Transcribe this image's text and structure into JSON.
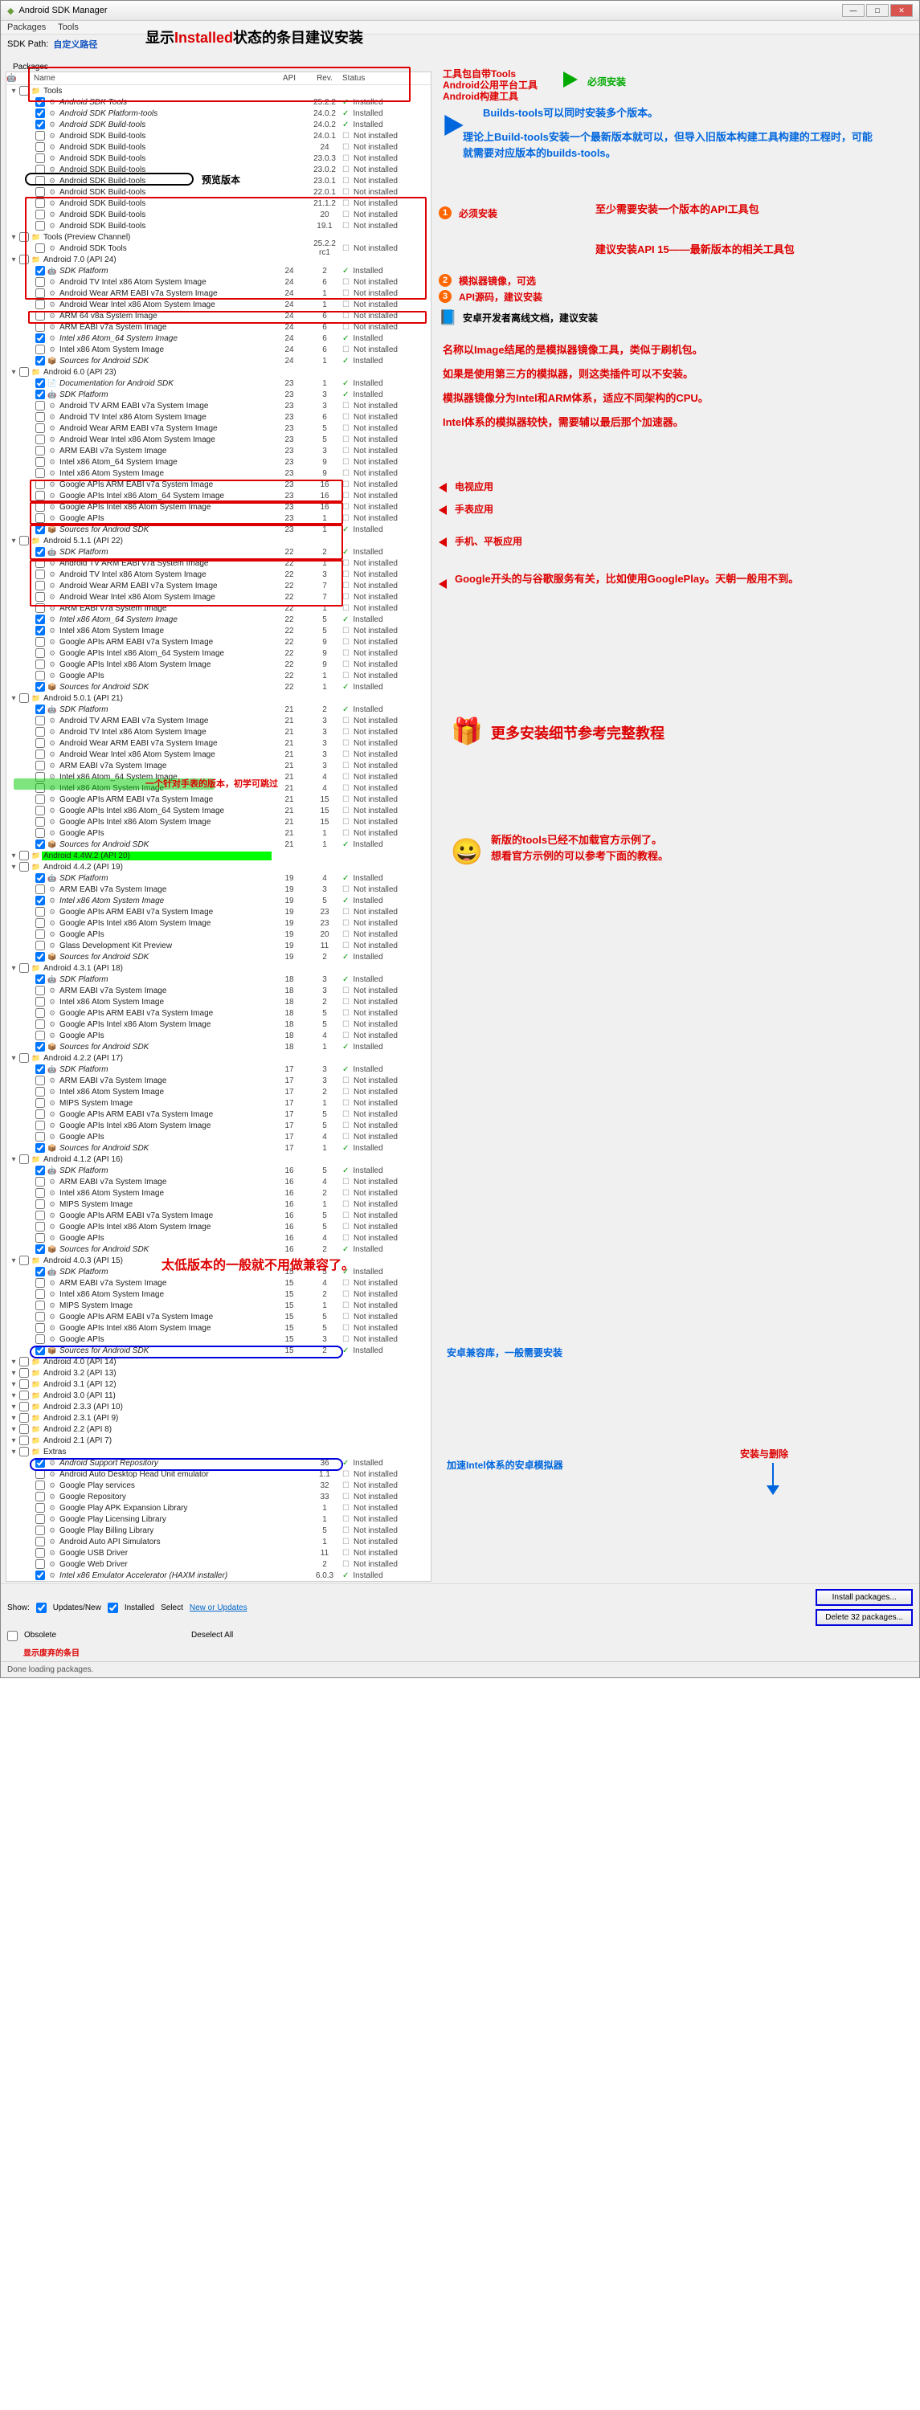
{
  "window": {
    "title": "Android SDK Manager"
  },
  "menu": {
    "packages": "Packages",
    "tools": "Tools"
  },
  "sdk": {
    "label": "SDK Path:",
    "path": "自定义路径"
  },
  "banner": {
    "pre": "显示",
    "mid": "Installed",
    "post": "状态的条目建议安装"
  },
  "cols": {
    "name": "Name",
    "api": "API",
    "rev": "Rev.",
    "status": "Status"
  },
  "status": {
    "installed": "Installed",
    "not": "Not installed"
  },
  "groups": [
    {
      "name": "Tools",
      "items": [
        {
          "n": "Android SDK Tools",
          "api": "",
          "rev": "25.2.2",
          "s": "i",
          "c": true
        },
        {
          "n": "Android SDK Platform-tools",
          "api": "",
          "rev": "24.0.2",
          "s": "i",
          "c": true
        },
        {
          "n": "Android SDK Build-tools",
          "api": "",
          "rev": "24.0.2",
          "s": "i",
          "c": true
        },
        {
          "n": "Android SDK Build-tools",
          "api": "",
          "rev": "24.0.1",
          "s": "n"
        },
        {
          "n": "Android SDK Build-tools",
          "api": "",
          "rev": "24",
          "s": "n"
        },
        {
          "n": "Android SDK Build-tools",
          "api": "",
          "rev": "23.0.3",
          "s": "n"
        },
        {
          "n": "Android SDK Build-tools",
          "api": "",
          "rev": "23.0.2",
          "s": "n"
        },
        {
          "n": "Android SDK Build-tools",
          "api": "",
          "rev": "23.0.1",
          "s": "n"
        },
        {
          "n": "Android SDK Build-tools",
          "api": "",
          "rev": "22.0.1",
          "s": "n"
        },
        {
          "n": "Android SDK Build-tools",
          "api": "",
          "rev": "21.1.2",
          "s": "n"
        },
        {
          "n": "Android SDK Build-tools",
          "api": "",
          "rev": "20",
          "s": "n"
        },
        {
          "n": "Android SDK Build-tools",
          "api": "",
          "rev": "19.1",
          "s": "n"
        }
      ]
    },
    {
      "name": "Tools (Preview Channel)",
      "items": [
        {
          "n": "Android SDK Tools",
          "api": "",
          "rev": "25.2.2 rc1",
          "s": "n"
        }
      ]
    },
    {
      "name": "Android 7.0 (API 24)",
      "items": [
        {
          "n": "SDK Platform",
          "api": "24",
          "rev": "2",
          "s": "i",
          "c": true
        },
        {
          "n": "Android TV Intel x86 Atom System Image",
          "api": "24",
          "rev": "6",
          "s": "n"
        },
        {
          "n": "Android Wear ARM EABI v7a System Image",
          "api": "24",
          "rev": "1",
          "s": "n"
        },
        {
          "n": "Android Wear Intel x86 Atom System Image",
          "api": "24",
          "rev": "1",
          "s": "n"
        },
        {
          "n": "ARM 64 v8a System Image",
          "api": "24",
          "rev": "6",
          "s": "n"
        },
        {
          "n": "ARM EABI v7a System Image",
          "api": "24",
          "rev": "6",
          "s": "n"
        },
        {
          "n": "Intel x86 Atom_64 System Image",
          "api": "24",
          "rev": "6",
          "s": "i",
          "c": true
        },
        {
          "n": "Intel x86 Atom System Image",
          "api": "24",
          "rev": "6",
          "s": "n"
        },
        {
          "n": "Sources for Android SDK",
          "api": "24",
          "rev": "1",
          "s": "i",
          "c": true
        }
      ]
    },
    {
      "name": "Android 6.0 (API 23)",
      "items": [
        {
          "n": "Documentation for Android SDK",
          "api": "23",
          "rev": "1",
          "s": "i",
          "c": true
        },
        {
          "n": "SDK Platform",
          "api": "23",
          "rev": "3",
          "s": "i",
          "c": true
        },
        {
          "n": "Android TV ARM EABI v7a System Image",
          "api": "23",
          "rev": "3",
          "s": "n"
        },
        {
          "n": "Android TV Intel x86 Atom System Image",
          "api": "23",
          "rev": "6",
          "s": "n"
        },
        {
          "n": "Android Wear ARM EABI v7a System Image",
          "api": "23",
          "rev": "5",
          "s": "n"
        },
        {
          "n": "Android Wear Intel x86 Atom System Image",
          "api": "23",
          "rev": "5",
          "s": "n"
        },
        {
          "n": "ARM EABI v7a System Image",
          "api": "23",
          "rev": "3",
          "s": "n"
        },
        {
          "n": "Intel x86 Atom_64 System Image",
          "api": "23",
          "rev": "9",
          "s": "n"
        },
        {
          "n": "Intel x86 Atom System Image",
          "api": "23",
          "rev": "9",
          "s": "n"
        },
        {
          "n": "Google APIs ARM EABI v7a System Image",
          "api": "23",
          "rev": "16",
          "s": "n"
        },
        {
          "n": "Google APIs Intel x86 Atom_64 System Image",
          "api": "23",
          "rev": "16",
          "s": "n"
        },
        {
          "n": "Google APIs Intel x86 Atom System Image",
          "api": "23",
          "rev": "16",
          "s": "n"
        },
        {
          "n": "Google APIs",
          "api": "23",
          "rev": "1",
          "s": "n"
        },
        {
          "n": "Sources for Android SDK",
          "api": "23",
          "rev": "1",
          "s": "i",
          "c": true
        }
      ]
    },
    {
      "name": "Android 5.1.1 (API 22)",
      "items": [
        {
          "n": "SDK Platform",
          "api": "22",
          "rev": "2",
          "s": "i",
          "c": true
        },
        {
          "n": "Android TV ARM EABI v7a System Image",
          "api": "22",
          "rev": "1",
          "s": "n"
        },
        {
          "n": "Android TV Intel x86 Atom System Image",
          "api": "22",
          "rev": "3",
          "s": "n"
        },
        {
          "n": "Android Wear ARM EABI v7a System Image",
          "api": "22",
          "rev": "7",
          "s": "n"
        },
        {
          "n": "Android Wear Intel x86 Atom System Image",
          "api": "22",
          "rev": "7",
          "s": "n"
        },
        {
          "n": "ARM EABI v7a System Image",
          "api": "22",
          "rev": "1",
          "s": "n"
        },
        {
          "n": "Intel x86 Atom_64 System Image",
          "api": "22",
          "rev": "5",
          "s": "i",
          "c": true
        },
        {
          "n": "Intel x86 Atom System Image",
          "api": "22",
          "rev": "5",
          "s": "n",
          "c": true
        },
        {
          "n": "Google APIs ARM EABI v7a System Image",
          "api": "22",
          "rev": "9",
          "s": "n"
        },
        {
          "n": "Google APIs Intel x86 Atom_64 System Image",
          "api": "22",
          "rev": "9",
          "s": "n"
        },
        {
          "n": "Google APIs Intel x86 Atom System Image",
          "api": "22",
          "rev": "9",
          "s": "n"
        },
        {
          "n": "Google APIs",
          "api": "22",
          "rev": "1",
          "s": "n"
        },
        {
          "n": "Sources for Android SDK",
          "api": "22",
          "rev": "1",
          "s": "i",
          "c": true
        }
      ]
    },
    {
      "name": "Android 5.0.1 (API 21)",
      "items": [
        {
          "n": "SDK Platform",
          "api": "21",
          "rev": "2",
          "s": "i",
          "c": true
        },
        {
          "n": "Android TV ARM EABI v7a System Image",
          "api": "21",
          "rev": "3",
          "s": "n"
        },
        {
          "n": "Android TV Intel x86 Atom System Image",
          "api": "21",
          "rev": "3",
          "s": "n"
        },
        {
          "n": "Android Wear ARM EABI v7a System Image",
          "api": "21",
          "rev": "3",
          "s": "n"
        },
        {
          "n": "Android Wear Intel x86 Atom System Image",
          "api": "21",
          "rev": "3",
          "s": "n"
        },
        {
          "n": "ARM EABI v7a System Image",
          "api": "21",
          "rev": "3",
          "s": "n"
        },
        {
          "n": "Intel x86 Atom_64 System Image",
          "api": "21",
          "rev": "4",
          "s": "n"
        },
        {
          "n": "Intel x86 Atom System Image",
          "api": "21",
          "rev": "4",
          "s": "n"
        },
        {
          "n": "Google APIs ARM EABI v7a System Image",
          "api": "21",
          "rev": "15",
          "s": "n"
        },
        {
          "n": "Google APIs Intel x86 Atom_64 System Image",
          "api": "21",
          "rev": "15",
          "s": "n"
        },
        {
          "n": "Google APIs Intel x86 Atom System Image",
          "api": "21",
          "rev": "15",
          "s": "n"
        },
        {
          "n": "Google APIs",
          "api": "21",
          "rev": "1",
          "s": "n"
        },
        {
          "n": "Sources for Android SDK",
          "api": "21",
          "rev": "1",
          "s": "i",
          "c": true
        }
      ]
    },
    {
      "name": "Android 4.4W.2 (API 20)",
      "hl": "green",
      "items": []
    },
    {
      "name": "Android 4.4.2 (API 19)",
      "items": [
        {
          "n": "SDK Platform",
          "api": "19",
          "rev": "4",
          "s": "i",
          "c": true
        },
        {
          "n": "ARM EABI v7a System Image",
          "api": "19",
          "rev": "3",
          "s": "n"
        },
        {
          "n": "Intel x86 Atom System Image",
          "api": "19",
          "rev": "5",
          "s": "i",
          "c": true
        },
        {
          "n": "Google APIs ARM EABI v7a System Image",
          "api": "19",
          "rev": "23",
          "s": "n"
        },
        {
          "n": "Google APIs Intel x86 Atom System Image",
          "api": "19",
          "rev": "23",
          "s": "n"
        },
        {
          "n": "Google APIs",
          "api": "19",
          "rev": "20",
          "s": "n"
        },
        {
          "n": "Glass Development Kit Preview",
          "api": "19",
          "rev": "11",
          "s": "n"
        },
        {
          "n": "Sources for Android SDK",
          "api": "19",
          "rev": "2",
          "s": "i",
          "c": true
        }
      ]
    },
    {
      "name": "Android 4.3.1 (API 18)",
      "items": [
        {
          "n": "SDK Platform",
          "api": "18",
          "rev": "3",
          "s": "i",
          "c": true
        },
        {
          "n": "ARM EABI v7a System Image",
          "api": "18",
          "rev": "3",
          "s": "n"
        },
        {
          "n": "Intel x86 Atom System Image",
          "api": "18",
          "rev": "2",
          "s": "n"
        },
        {
          "n": "Google APIs ARM EABI v7a System Image",
          "api": "18",
          "rev": "5",
          "s": "n"
        },
        {
          "n": "Google APIs Intel x86 Atom System Image",
          "api": "18",
          "rev": "5",
          "s": "n"
        },
        {
          "n": "Google APIs",
          "api": "18",
          "rev": "4",
          "s": "n"
        },
        {
          "n": "Sources for Android SDK",
          "api": "18",
          "rev": "1",
          "s": "i",
          "c": true
        }
      ]
    },
    {
      "name": "Android 4.2.2 (API 17)",
      "items": [
        {
          "n": "SDK Platform",
          "api": "17",
          "rev": "3",
          "s": "i",
          "c": true
        },
        {
          "n": "ARM EABI v7a System Image",
          "api": "17",
          "rev": "3",
          "s": "n"
        },
        {
          "n": "Intel x86 Atom System Image",
          "api": "17",
          "rev": "2",
          "s": "n"
        },
        {
          "n": "MIPS System Image",
          "api": "17",
          "rev": "1",
          "s": "n"
        },
        {
          "n": "Google APIs ARM EABI v7a System Image",
          "api": "17",
          "rev": "5",
          "s": "n"
        },
        {
          "n": "Google APIs Intel x86 Atom System Image",
          "api": "17",
          "rev": "5",
          "s": "n"
        },
        {
          "n": "Google APIs",
          "api": "17",
          "rev": "4",
          "s": "n"
        },
        {
          "n": "Sources for Android SDK",
          "api": "17",
          "rev": "1",
          "s": "i",
          "c": true
        }
      ]
    },
    {
      "name": "Android 4.1.2 (API 16)",
      "items": [
        {
          "n": "SDK Platform",
          "api": "16",
          "rev": "5",
          "s": "i",
          "c": true
        },
        {
          "n": "ARM EABI v7a System Image",
          "api": "16",
          "rev": "4",
          "s": "n"
        },
        {
          "n": "Intel x86 Atom System Image",
          "api": "16",
          "rev": "2",
          "s": "n"
        },
        {
          "n": "MIPS System Image",
          "api": "16",
          "rev": "1",
          "s": "n"
        },
        {
          "n": "Google APIs ARM EABI v7a System Image",
          "api": "16",
          "rev": "5",
          "s": "n"
        },
        {
          "n": "Google APIs Intel x86 Atom System Image",
          "api": "16",
          "rev": "5",
          "s": "n"
        },
        {
          "n": "Google APIs",
          "api": "16",
          "rev": "4",
          "s": "n"
        },
        {
          "n": "Sources for Android SDK",
          "api": "16",
          "rev": "2",
          "s": "i",
          "c": true
        }
      ]
    },
    {
      "name": "Android 4.0.3 (API 15)",
      "items": [
        {
          "n": "SDK Platform",
          "api": "15",
          "rev": "5",
          "s": "i",
          "c": true
        },
        {
          "n": "ARM EABI v7a System Image",
          "api": "15",
          "rev": "4",
          "s": "n"
        },
        {
          "n": "Intel x86 Atom System Image",
          "api": "15",
          "rev": "2",
          "s": "n"
        },
        {
          "n": "MIPS System Image",
          "api": "15",
          "rev": "1",
          "s": "n"
        },
        {
          "n": "Google APIs ARM EABI v7a System Image",
          "api": "15",
          "rev": "5",
          "s": "n"
        },
        {
          "n": "Google APIs Intel x86 Atom System Image",
          "api": "15",
          "rev": "5",
          "s": "n"
        },
        {
          "n": "Google APIs",
          "api": "15",
          "rev": "3",
          "s": "n"
        },
        {
          "n": "Sources for Android SDK",
          "api": "15",
          "rev": "2",
          "s": "i",
          "c": true
        }
      ]
    },
    {
      "name": "Android 4.0 (API 14)",
      "items": []
    },
    {
      "name": "Android 3.2 (API 13)",
      "items": []
    },
    {
      "name": "Android 3.1 (API 12)",
      "items": []
    },
    {
      "name": "Android 3.0 (API 11)",
      "items": []
    },
    {
      "name": "Android 2.3.3 (API 10)",
      "items": []
    },
    {
      "name": "Android 2.3.1 (API 9)",
      "items": []
    },
    {
      "name": "Android 2.2 (API 8)",
      "items": []
    },
    {
      "name": "Android 2.1 (API 7)",
      "items": []
    },
    {
      "name": "Extras",
      "items": [
        {
          "n": "Android Support Repository",
          "api": "",
          "rev": "36",
          "s": "i",
          "c": true
        },
        {
          "n": "Android Auto Desktop Head Unit emulator",
          "api": "",
          "rev": "1.1",
          "s": "n"
        },
        {
          "n": "Google Play services",
          "api": "",
          "rev": "32",
          "s": "n"
        },
        {
          "n": "Google Repository",
          "api": "",
          "rev": "33",
          "s": "n"
        },
        {
          "n": "Google Play APK Expansion Library",
          "api": "",
          "rev": "1",
          "s": "n"
        },
        {
          "n": "Google Play Licensing Library",
          "api": "",
          "rev": "1",
          "s": "n"
        },
        {
          "n": "Google Play Billing Library",
          "api": "",
          "rev": "5",
          "s": "n"
        },
        {
          "n": "Android Auto API Simulators",
          "api": "",
          "rev": "1",
          "s": "n"
        },
        {
          "n": "Google USB Driver",
          "api": "",
          "rev": "11",
          "s": "n"
        },
        {
          "n": "Google Web Driver",
          "api": "",
          "rev": "2",
          "s": "n"
        },
        {
          "n": "Intel x86 Emulator Accelerator (HAXM installer)",
          "api": "",
          "rev": "6.0.3",
          "s": "i",
          "c": true
        }
      ]
    }
  ],
  "footer": {
    "show": "Show:",
    "updates": "Updates/New",
    "installed": "Installed",
    "select": "Select ",
    "new_up": "New or Updates",
    "obsolete": "Obsolete",
    "deselect": "Deselect All",
    "install_btn": "Install packages...",
    "delete_btn": "Delete 32 packages...",
    "abandoned": "显示废弃的条目"
  },
  "status_bar": "Done loading packages.",
  "anno": {
    "a1": "工具包自带Tools",
    "a2": "Android公用平台工具",
    "a3": "Android构建工具",
    "must": "必须安装",
    "b1": "Builds-tools可以同时安装多个版本。",
    "b2": "理论上Build-tools安装一个最新版本就可以，但导入旧版本构建工具构建的工程时，可能就需要对应版本的builds-tools。",
    "preview": "预览版本",
    "must2": "必须安装",
    "api_pkg": "至少需要安装一个版本的API工具包",
    "api15": "建议安装API 15——最新版本的相关工具包",
    "sim": "模拟器镜像，可选",
    "src": "API源码，建议安装",
    "doc": "安卓开发者离线文档，建议安装",
    "img1": "名称以Image结尾的是模拟器镜像工具，类似于刷机包。",
    "img2": "如果是使用第三方的模拟器，则这类插件可以不安装。",
    "img3": "模拟器镜像分为Intel和ARM体系，适应不同架构的CPU。",
    "img4": "Intel体系的模拟器较快，需要辅以最后那个加速器。",
    "tv": "电视应用",
    "watch": "手表应用",
    "phone": "手机、平板应用",
    "gapi": "Google开头的与谷歌服务有关，比如使用GooglePlay。天朝一般用不到。",
    "more": "更多安装细节参考完整教程",
    "w20": "一个针对手表的版本，初学可跳过",
    "tools_note1": "新版的tools已经不加载官方示例了。",
    "tools_note2": "想看官方示例的可以参考下面的教程。",
    "too_low": "太低版本的一般就不用做兼容了。",
    "support": "安卓兼容库，一般需要安装",
    "save_del": "安装与删除",
    "haxm": "加速Intel体系的安卓模拟器"
  }
}
